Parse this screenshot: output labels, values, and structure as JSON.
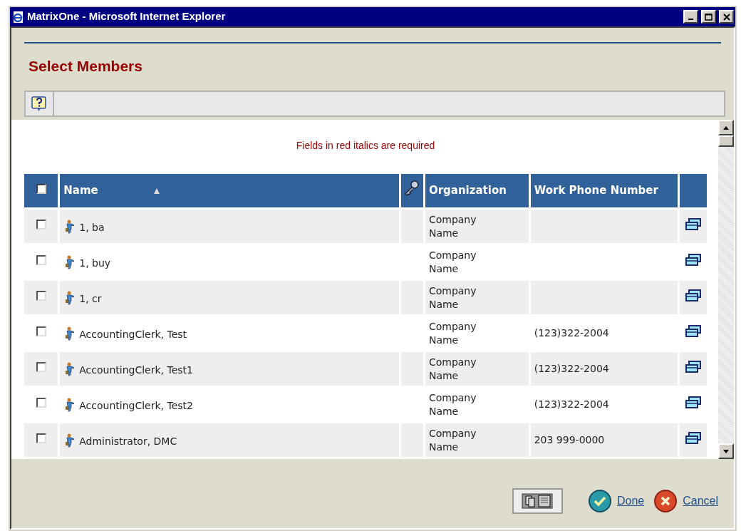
{
  "window": {
    "title": "MatrixOne - Microsoft Internet Explorer"
  },
  "page_title": "Select Members",
  "required_note": "Fields in red italics are required",
  "table": {
    "select_all": {
      "checked": false
    },
    "columns": [
      {
        "label": "Name",
        "sorted": true
      },
      {
        "kind": "key"
      },
      {
        "label": "Organization"
      },
      {
        "label": "Work Phone Number"
      }
    ],
    "rows": [
      {
        "checked": false,
        "name": "1, ba",
        "organization": "Company Name",
        "phone": ""
      },
      {
        "checked": false,
        "name": "1, buy",
        "organization": "Company Name",
        "phone": ""
      },
      {
        "checked": false,
        "name": "1, cr",
        "organization": "Company Name",
        "phone": ""
      },
      {
        "checked": false,
        "name": "AccountingClerk, Test",
        "organization": "Company Name",
        "phone": "(123)322-2004"
      },
      {
        "checked": false,
        "name": "AccountingClerk, Test1",
        "organization": "Company Name",
        "phone": "(123)322-2004"
      },
      {
        "checked": false,
        "name": "AccountingClerk, Test2",
        "organization": "Company Name",
        "phone": "(123)322-2004"
      },
      {
        "checked": false,
        "name": "Administrator, DMC",
        "organization": "Company Name",
        "phone": "203 999-0000"
      }
    ]
  },
  "footer": {
    "done": "Done",
    "cancel": "Cancel"
  }
}
